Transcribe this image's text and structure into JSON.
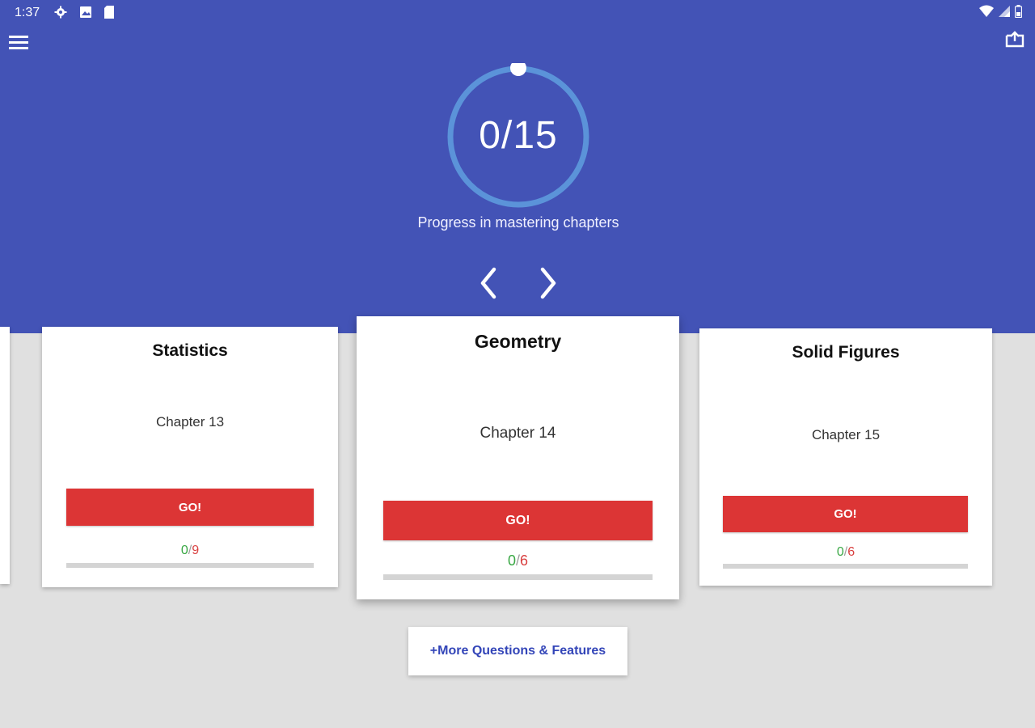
{
  "status_bar": {
    "time": "1:37",
    "icons": [
      "gear-icon",
      "image-icon",
      "sd-card-icon"
    ],
    "right_icons": [
      "wifi-icon",
      "signal-icon",
      "battery-icon"
    ]
  },
  "toolbar": {
    "menu_icon": "hamburger-menu-icon",
    "export_icon": "export-icon"
  },
  "progress": {
    "value_text": "0/15",
    "mastered": 0,
    "total": 15,
    "label": "Progress in mastering chapters"
  },
  "nav": {
    "prev_icon": "chevron-left-icon",
    "next_icon": "chevron-right-icon"
  },
  "cards": [
    {
      "title": "Statistics",
      "chapter": "Chapter 13",
      "go_label": "GO!",
      "done": "0",
      "sep": "/",
      "total": "9"
    },
    {
      "title": "Geometry",
      "chapter": "Chapter 14",
      "go_label": "GO!",
      "done": "0",
      "sep": "/",
      "total": "6"
    },
    {
      "title": "Solid Figures",
      "chapter": "Chapter 15",
      "go_label": "GO!",
      "done": "0",
      "sep": "/",
      "total": "6"
    }
  ],
  "more_button": {
    "label": "+More Questions & Features"
  },
  "colors": {
    "header": "#4353b6",
    "ring": "#5b93d9",
    "go_button": "#dc3535",
    "score_done": "#3aa845",
    "score_total": "#d93f3f",
    "background": "#e0e0e0"
  }
}
